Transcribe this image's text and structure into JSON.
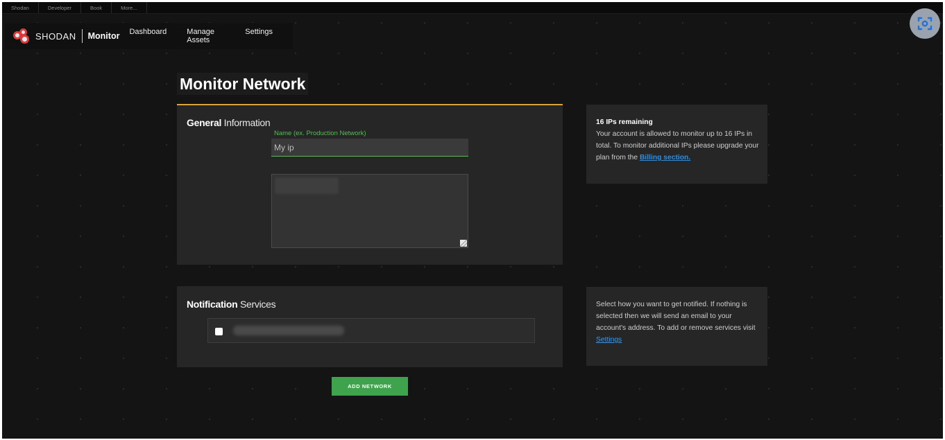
{
  "topbar": {
    "links": [
      "Shodan",
      "Developer",
      "Book",
      "More..."
    ]
  },
  "nav": {
    "logo_word": "SHODAN",
    "logo_sub": "Monitor",
    "links": [
      "Dashboard",
      "Manage Assets",
      "Settings"
    ]
  },
  "page": {
    "title": "Monitor Network"
  },
  "general": {
    "title_bold": "General",
    "title_rest": " Information",
    "name_label": "Name (ex. Production Network)",
    "name_value": "My ip"
  },
  "info": {
    "heading": "16 IPs remaining",
    "text": "Your account is allowed to monitor up to 16 IPs in total. To monitor additional IPs please upgrade your plan from the ",
    "link": "Billing section."
  },
  "notifications": {
    "title_bold": "Notification",
    "title_rest": " Services"
  },
  "notify_info": {
    "text": "Select how you want to get notified. If nothing is selected then we will send an email to your account's address. To add or remove services visit ",
    "link": "Settings"
  },
  "actions": {
    "add_network": "ADD NETWORK"
  },
  "icons": {
    "lens": "google-lens-icon",
    "logo": "shodan-logo-icon"
  },
  "colors": {
    "accent_green": "#3fa34d",
    "label_green": "#5cb85c",
    "accent_orange": "#d9a441",
    "link_blue": "#2f8ee0"
  }
}
